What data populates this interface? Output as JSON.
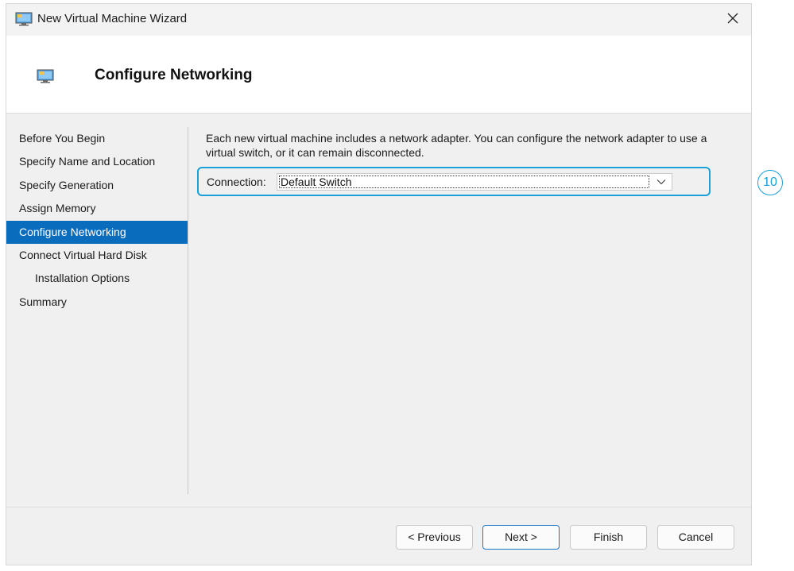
{
  "window": {
    "title": "New Virtual Machine Wizard",
    "title_icon": "hyperv-monitor-icon",
    "close_icon": "close-icon"
  },
  "header": {
    "title": "Configure Networking",
    "icon": "hyperv-monitor-icon"
  },
  "sidebar": {
    "items": [
      {
        "label": "Before You Begin",
        "active": false,
        "indent": false
      },
      {
        "label": "Specify Name and Location",
        "active": false,
        "indent": false
      },
      {
        "label": "Specify Generation",
        "active": false,
        "indent": false
      },
      {
        "label": "Assign Memory",
        "active": false,
        "indent": false
      },
      {
        "label": "Configure Networking",
        "active": true,
        "indent": false
      },
      {
        "label": "Connect Virtual Hard Disk",
        "active": false,
        "indent": false
      },
      {
        "label": "Installation Options",
        "active": false,
        "indent": true
      },
      {
        "label": "Summary",
        "active": false,
        "indent": false
      }
    ]
  },
  "content": {
    "description": "Each new virtual machine includes a network adapter. You can configure the network adapter to use a virtual switch, or it can remain disconnected.",
    "connection_label": "Connection:",
    "connection_value": "Default Switch",
    "dropdown_icon": "chevron-down-icon"
  },
  "callout": {
    "number": "10"
  },
  "buttons": {
    "previous": "< Previous",
    "next": "Next >",
    "finish": "Finish",
    "cancel": "Cancel"
  },
  "colors": {
    "accent": "#0a6cbd",
    "highlight_border": "#1a9fd6"
  }
}
